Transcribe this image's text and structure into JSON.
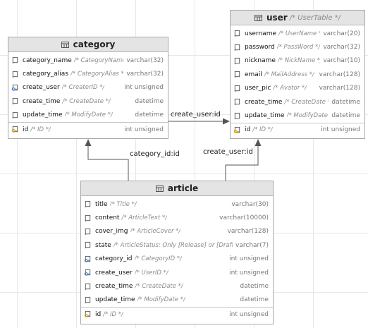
{
  "entities": {
    "category": {
      "name": "category",
      "comment": "",
      "columns": [
        {
          "name": "category_name",
          "comment": "/* CategoryName */",
          "type": "varchar(32)",
          "kind": "field"
        },
        {
          "name": "category_alias",
          "comment": "/* CategoryAlias */",
          "type": "varchar(32)",
          "kind": "field"
        },
        {
          "name": "create_user",
          "comment": "/* CreaterID */",
          "type": "int unsigned",
          "kind": "fk"
        },
        {
          "name": "create_time",
          "comment": "/* CreateDate */",
          "type": "datetime",
          "kind": "field"
        },
        {
          "name": "update_time",
          "comment": "/* ModifyDate */",
          "type": "datetime",
          "kind": "field"
        },
        {
          "name": "id",
          "comment": "/* ID */",
          "type": "int unsigned",
          "kind": "pk"
        }
      ]
    },
    "user": {
      "name": "user",
      "comment": "/* UserTable */",
      "columns": [
        {
          "name": "username",
          "comment": "/* UserName */",
          "type": "varchar(20)",
          "kind": "field"
        },
        {
          "name": "password",
          "comment": "/* PassWord */",
          "type": "varchar(32)",
          "kind": "field"
        },
        {
          "name": "nickname",
          "comment": "/* NickName */",
          "type": "varchar(10)",
          "kind": "field"
        },
        {
          "name": "email",
          "comment": "/* MailAddress */",
          "type": "varchar(128)",
          "kind": "field"
        },
        {
          "name": "user_pic",
          "comment": "/* Avator */",
          "type": "varchar(128)",
          "kind": "field"
        },
        {
          "name": "create_time",
          "comment": "/* CreateDate */",
          "type": "datetime",
          "kind": "field"
        },
        {
          "name": "update_time",
          "comment": "/* ModifyDate */",
          "type": "datetime",
          "kind": "field"
        },
        {
          "name": "id",
          "comment": "/* ID */",
          "type": "int unsigned",
          "kind": "pk"
        }
      ]
    },
    "article": {
      "name": "article",
      "comment": "",
      "columns": [
        {
          "name": "title",
          "comment": "/* Title */",
          "type": "varchar(30)",
          "kind": "field"
        },
        {
          "name": "content",
          "comment": "/* ArticleText */",
          "type": "varchar(10000)",
          "kind": "field"
        },
        {
          "name": "cover_img",
          "comment": "/* ArticleCover */",
          "type": "varchar(128)",
          "kind": "field"
        },
        {
          "name": "state",
          "comment": "/* ArticleStatus: Only [Release] or [Draft] */",
          "type": "varchar(7)",
          "kind": "field"
        },
        {
          "name": "category_id",
          "comment": "/* CategoryID */",
          "type": "int unsigned",
          "kind": "fk"
        },
        {
          "name": "create_user",
          "comment": "/* UserID */",
          "type": "int unsigned",
          "kind": "fk"
        },
        {
          "name": "create_time",
          "comment": "/* CreateDate */",
          "type": "datetime",
          "kind": "field"
        },
        {
          "name": "update_time",
          "comment": "/* ModifyDate */",
          "type": "datetime",
          "kind": "field"
        },
        {
          "name": "id",
          "comment": "/* ID */",
          "type": "int unsigned",
          "kind": "pk"
        }
      ]
    }
  },
  "relations": [
    {
      "label": "create_user:id",
      "from": "category",
      "to": "user"
    },
    {
      "label": "category_id:id",
      "from": "article",
      "to": "category"
    },
    {
      "label": "create_user:id",
      "from": "article",
      "to": "user"
    }
  ],
  "colors": {
    "background": "#ffffff",
    "grid": "#e7e7e7",
    "header": "#e4e4e4",
    "border": "#a9a9a9",
    "icon": "#555555",
    "fk_key": "#4a7fbf",
    "pk_key": "#d9a21b",
    "type_text": "#777777",
    "comment_text": "#8b8b8b",
    "edge": "#555555"
  }
}
